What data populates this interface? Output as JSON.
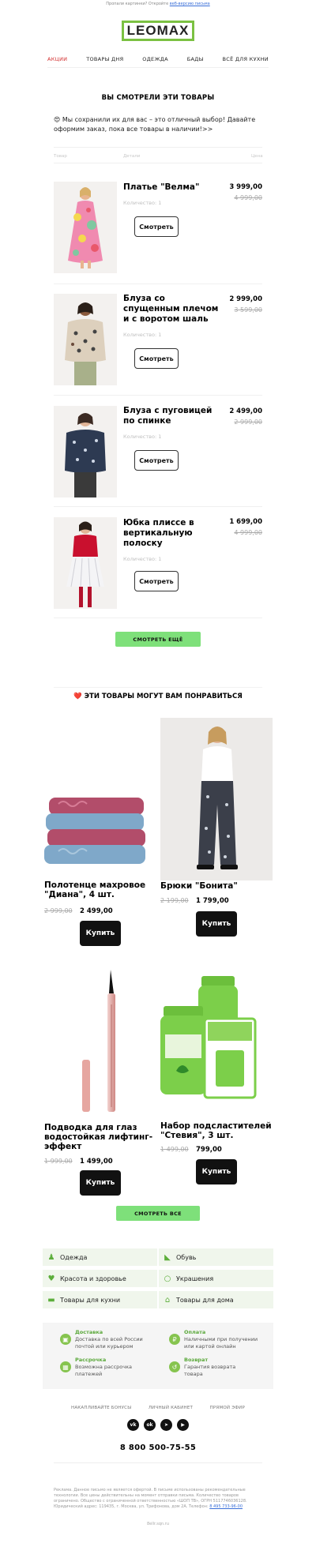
{
  "preheader": {
    "text": "Пропали картинки? Откройте ",
    "link": "веб-версию письма"
  },
  "logo": "LEOMAX",
  "nav": [
    "АКЦИИ",
    "ТОВАРЫ ДНЯ",
    "ОДЕЖДА",
    "БАДЫ",
    "ВСЁ ДЛЯ КУХНИ"
  ],
  "viewed": {
    "title": "ВЫ СМОТРЕЛИ ЭТИ ТОВАРЫ",
    "intro": "😍 Мы сохранили их для вас – это отличный выбор! Давайте оформим заказ, пока все товары в наличии!>>",
    "col_product": "Товар",
    "col_details": "Детали",
    "col_price": "Цена",
    "items": [
      {
        "name": "Платье \"Велма\"",
        "qty": "Количество: 1",
        "price": "3 999,00",
        "old": "4 999,00",
        "button": "Смотреть"
      },
      {
        "name": "Блуза со спущенным плечом и с воротом шаль",
        "qty": "Количество: 1",
        "price": "2 999,00",
        "old": "3 599,00",
        "button": "Смотреть"
      },
      {
        "name": "Блуза с пуговицей по спинке",
        "qty": "Количество: 1",
        "price": "2 499,00",
        "old": "2 999,00",
        "button": "Смотреть"
      },
      {
        "name": "Юбка плиссе в вертикальную полоску",
        "qty": "Количество: 1",
        "price": "1 699,00",
        "old": "4 999,00",
        "button": "Смотреть"
      }
    ],
    "more_button": "СМОТРЕТЬ ЕЩЁ"
  },
  "recommend": {
    "title": "❤️ ЭТИ ТОВАРЫ МОГУТ ВАМ ПОНРАВИТЬСЯ",
    "cards": [
      {
        "name": "Полотенце махровое \"Диана\", 4 шт.",
        "old": "2 999,00",
        "price": "2 499,00",
        "button": "Купить"
      },
      {
        "name": "Брюки \"Бонита\"",
        "old": "2 199,00",
        "price": "1 799,00",
        "button": "Купить"
      },
      {
        "name": "Подводка для глаз водостойкая лифтинг-эффект",
        "old": "1 999,00",
        "price": "1 499,00",
        "button": "Купить"
      },
      {
        "name": "Набор подсластителей \"Стевия\", 3 шт.",
        "old": "1 499,00",
        "price": "799,00",
        "button": "Купить"
      }
    ],
    "all_button": "СМОТРЕТЬ ВСЕ"
  },
  "categories": [
    "Одежда",
    "Обувь",
    "Красота и здоровье",
    "Украшения",
    "Товары для кухни",
    "Товары для дома"
  ],
  "info": [
    {
      "title": "Доставка",
      "text": "Доставка по всей России почтой или курьером"
    },
    {
      "title": "Оплата",
      "text": "Наличными при получении или картой онлайн"
    },
    {
      "title": "Рассрочка",
      "text": "Возможна рассрочка платежей"
    },
    {
      "title": "Возврат",
      "text": "Гарантия возврата товара"
    }
  ],
  "footer_links": [
    "НАКАПЛИВАЙТЕ БОНУСЫ",
    "ЛИЧНЫЙ КАБИНЕТ",
    "ПРЯМОЙ ЭФИР"
  ],
  "socials": [
    "vk",
    "ok",
    "tg",
    "yt"
  ],
  "phone": "8 800 500-75-55",
  "legal": {
    "text": "Реклама. Данное письмо не является офертой. В письме использованы рекомендательные технологии. Все цены действительны на момент отправки письма. Количество товаров ограничено. Общество с ограниченной ответственностью «ШОП ТВ», ОГРН 5117746036128. Юридический адрес: 119435, г. Москва, ул. Трифонова, дом 2А. Телефон: ",
    "phone_link": "8 495 733-96-00"
  },
  "site": "8ellr.sqn.ru",
  "colors": {
    "accent_green": "#7bc142",
    "button_green": "#7ee07a",
    "nav_active": "#d32f2f"
  }
}
